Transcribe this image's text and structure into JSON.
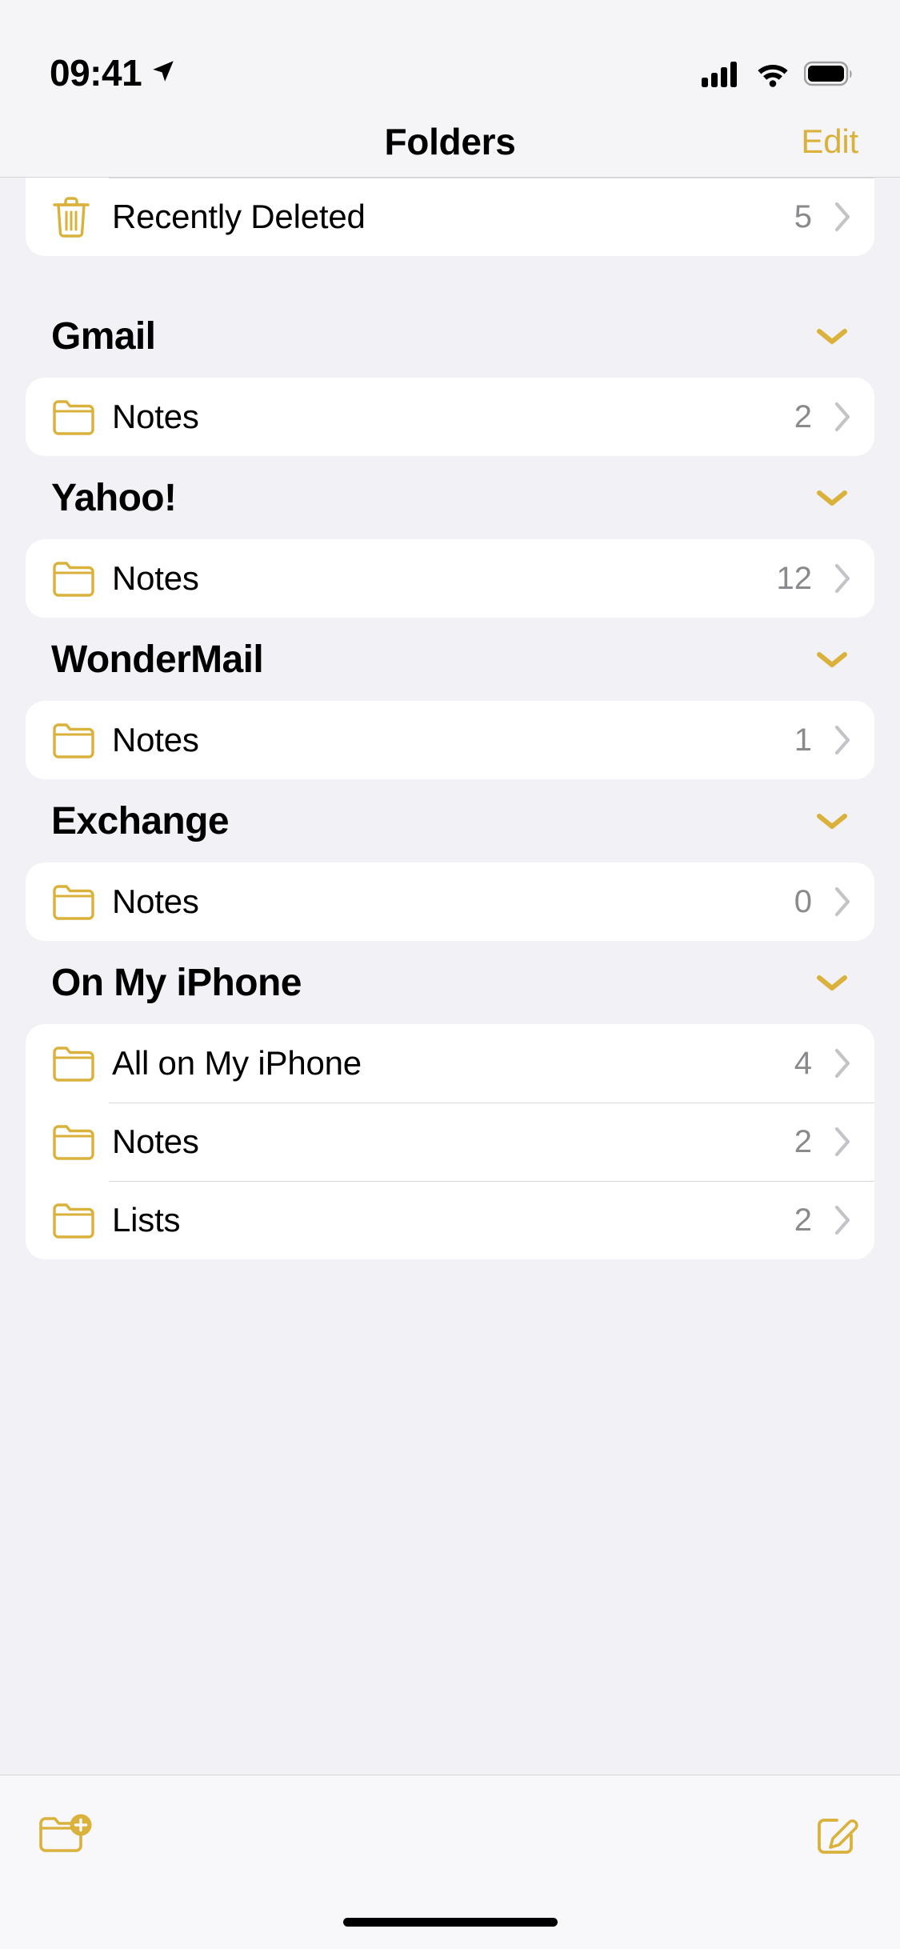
{
  "status_bar": {
    "time": "09:41",
    "location_icon": "location-arrow-icon",
    "cellular_icon": "cellular-signal-icon",
    "wifi_icon": "wifi-icon",
    "battery_icon": "battery-full-icon"
  },
  "nav": {
    "title": "Folders",
    "edit_label": "Edit"
  },
  "colors": {
    "accent": "#D9B13B",
    "background": "#F2F1F6",
    "card": "#FFFFFF",
    "count_text": "#8A8A8E",
    "chevron": "#C4C4C8"
  },
  "top_card": {
    "rows": [
      {
        "icon": "trash-icon",
        "label": "Recently Deleted",
        "count": "5"
      }
    ]
  },
  "sections": [
    {
      "title": "Gmail",
      "collapse_icon": "chevron-down-icon",
      "rows": [
        {
          "icon": "folder-icon",
          "label": "Notes",
          "count": "2"
        }
      ]
    },
    {
      "title": "Yahoo!",
      "collapse_icon": "chevron-down-icon",
      "rows": [
        {
          "icon": "folder-icon",
          "label": "Notes",
          "count": "12"
        }
      ]
    },
    {
      "title": "WonderMail",
      "collapse_icon": "chevron-down-icon",
      "rows": [
        {
          "icon": "folder-icon",
          "label": "Notes",
          "count": "1"
        }
      ]
    },
    {
      "title": "Exchange",
      "collapse_icon": "chevron-down-icon",
      "rows": [
        {
          "icon": "folder-icon",
          "label": "Notes",
          "count": "0"
        }
      ]
    },
    {
      "title": "On My iPhone",
      "collapse_icon": "chevron-down-icon",
      "rows": [
        {
          "icon": "folder-icon",
          "label": "All on My iPhone",
          "count": "4"
        },
        {
          "icon": "folder-icon",
          "label": "Notes",
          "count": "2"
        },
        {
          "icon": "folder-icon",
          "label": "Lists",
          "count": "2"
        }
      ]
    }
  ],
  "toolbar": {
    "new_folder_icon": "folder-plus-icon",
    "compose_icon": "compose-note-icon"
  }
}
